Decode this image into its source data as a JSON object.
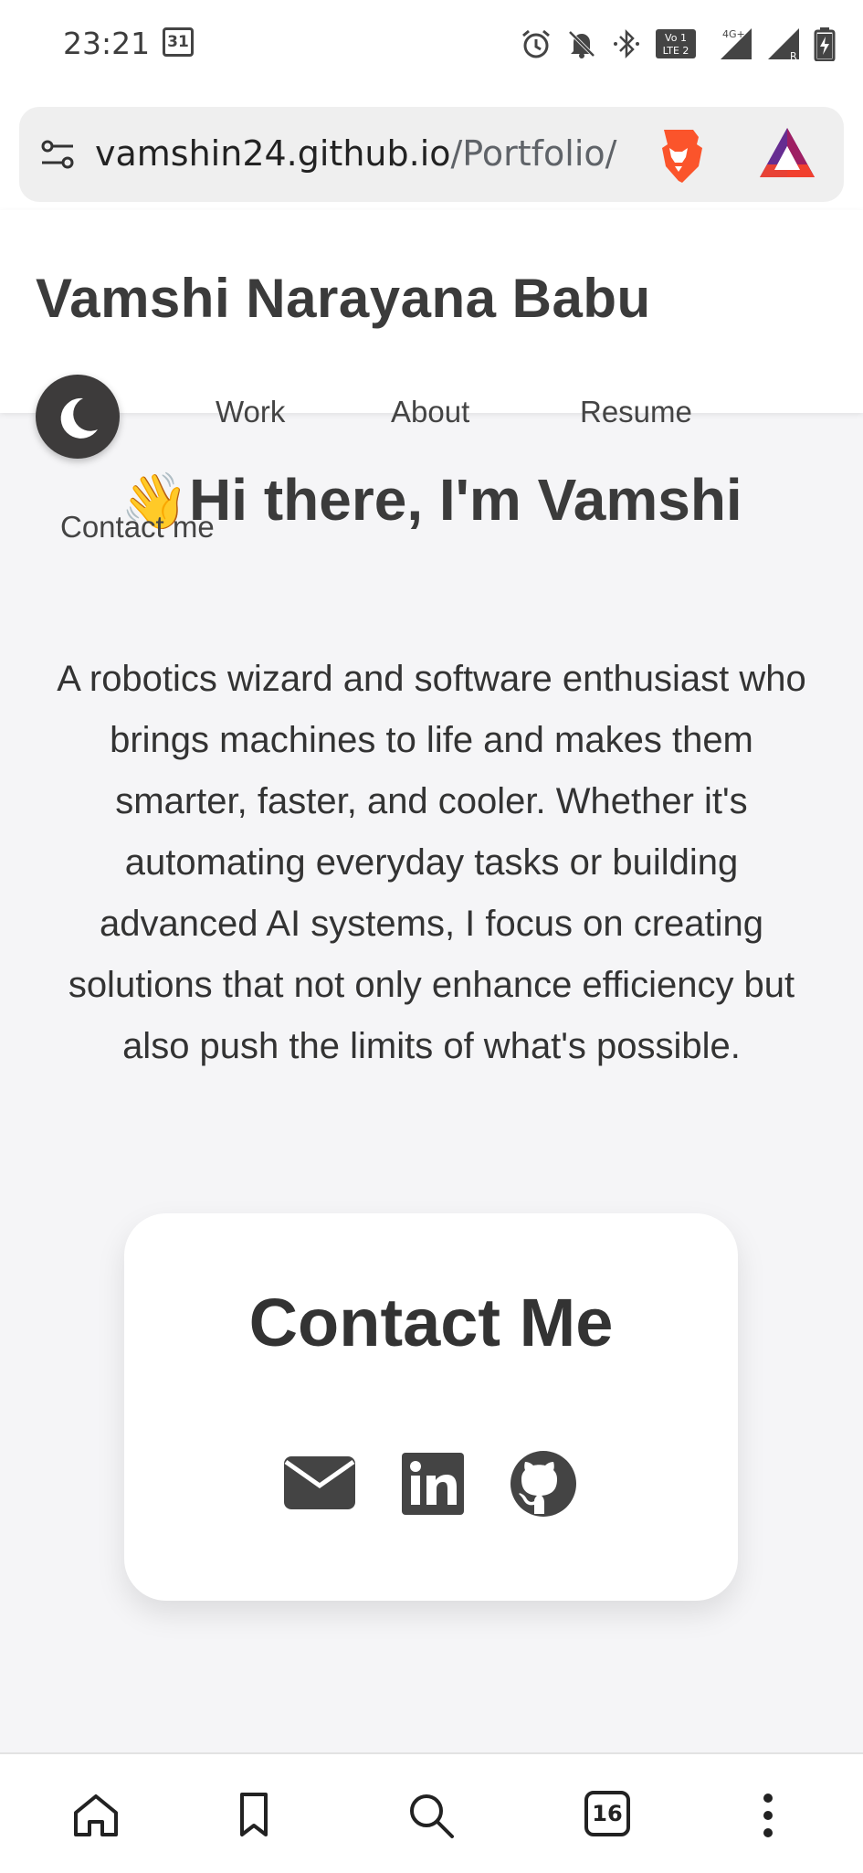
{
  "status_bar": {
    "time": "23:21",
    "calendar_day": "31",
    "icons": [
      "alarm-icon",
      "mute-icon",
      "bluetooth-icon",
      "volte-icon",
      "4g-signal-icon",
      "signal-roaming-icon",
      "battery-charging-icon"
    ]
  },
  "browser": {
    "url_domain": "vamshin24.github.io",
    "url_path": "/Portfolio/",
    "tab_count": "16"
  },
  "site": {
    "brand": "Vamshi Narayana Babu",
    "nav": {
      "work": "Work",
      "about": "About",
      "resume": "Resume",
      "contact": "Contact me"
    },
    "greeting_emoji": "👋",
    "greeting": "Hi there, I'm Vamshi",
    "bio": "A robotics wizard and software enthusiast who brings machines to life and makes them smarter, faster, and cooler. Whether it's automating everyday tasks or building advanced AI systems, I focus on creating solutions that not only enhance efficiency but also push the limits of what's possible.",
    "contact_title": "Contact Me"
  },
  "colors": {
    "page_bg": "#f5f5f7",
    "text_dark": "#3b3b3b",
    "toggle_bg": "#3d3b3b",
    "brave_orange": "#fb542b"
  }
}
